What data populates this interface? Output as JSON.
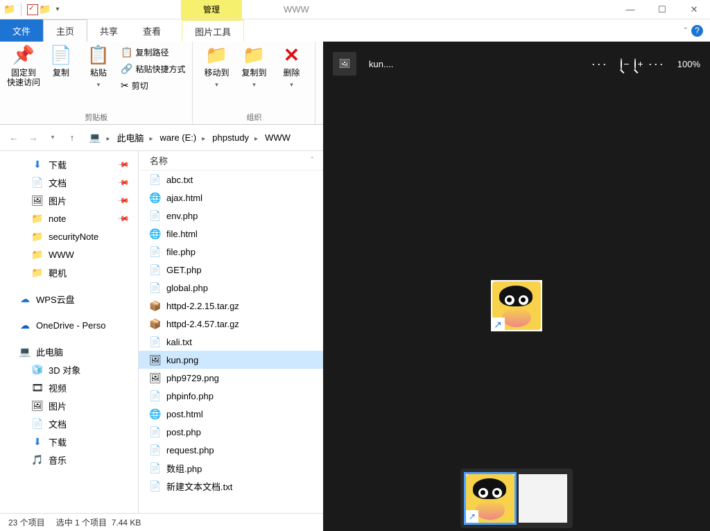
{
  "titlebar": {
    "manage": "管理",
    "title": "WWW"
  },
  "ribbon_tabs": {
    "file": "文件",
    "home": "主页",
    "share": "共享",
    "view": "查看",
    "img_tools": "图片工具"
  },
  "ribbon": {
    "pin": "固定到\n快速访问",
    "copy": "复制",
    "paste": "粘贴",
    "copypath": "复制路径",
    "pasteshort": "粘贴快捷方式",
    "cut": "剪切",
    "clipboard": "剪贴板",
    "moveto": "移动到",
    "copyto": "复制到",
    "delete": "删除",
    "organize": "组织"
  },
  "breadcrumb": [
    "此电脑",
    "ware (E:)",
    "phpstudy",
    "WWW"
  ],
  "nav": {
    "downloads": "下载",
    "documents": "文档",
    "pictures": "图片",
    "note": "note",
    "securityNote": "securityNote",
    "www": "WWW",
    "target": "靶机",
    "wps": "WPS云盘",
    "onedrive": "OneDrive - Perso",
    "thispc": "此电脑",
    "obj3d": "3D 对象",
    "videos": "视频",
    "pictures2": "图片",
    "documents2": "文档",
    "downloads2": "下载",
    "music": "音乐"
  },
  "filelist": {
    "header": "名称",
    "rows": [
      {
        "icon": "fi-txt",
        "name": "abc.txt"
      },
      {
        "icon": "fi-edge",
        "name": "ajax.html"
      },
      {
        "icon": "fi-php",
        "name": "env.php"
      },
      {
        "icon": "fi-edge",
        "name": "file.html"
      },
      {
        "icon": "fi-php",
        "name": "file.php"
      },
      {
        "icon": "fi-php",
        "name": "GET.php"
      },
      {
        "icon": "fi-php",
        "name": "global.php"
      },
      {
        "icon": "fi-gz",
        "name": "httpd-2.2.15.tar.gz"
      },
      {
        "icon": "fi-gz",
        "name": "httpd-2.4.57.tar.gz"
      },
      {
        "icon": "fi-txt",
        "name": "kali.txt"
      },
      {
        "icon": "fi-png",
        "name": "kun.png",
        "selected": true
      },
      {
        "icon": "fi-png",
        "name": "php9729.png"
      },
      {
        "icon": "fi-php",
        "name": "phpinfo.php"
      },
      {
        "icon": "fi-edge",
        "name": "post.html"
      },
      {
        "icon": "fi-php",
        "name": "post.php"
      },
      {
        "icon": "fi-php",
        "name": "request.php"
      },
      {
        "icon": "fi-php",
        "name": "数组.php"
      },
      {
        "icon": "fi-txt",
        "name": "新建文本文档.txt"
      }
    ]
  },
  "status": {
    "count": "23 个项目",
    "selected": "选中 1 个项目",
    "size": "7.44 KB"
  },
  "viewer": {
    "title": "kun....",
    "zoom": "100%"
  }
}
